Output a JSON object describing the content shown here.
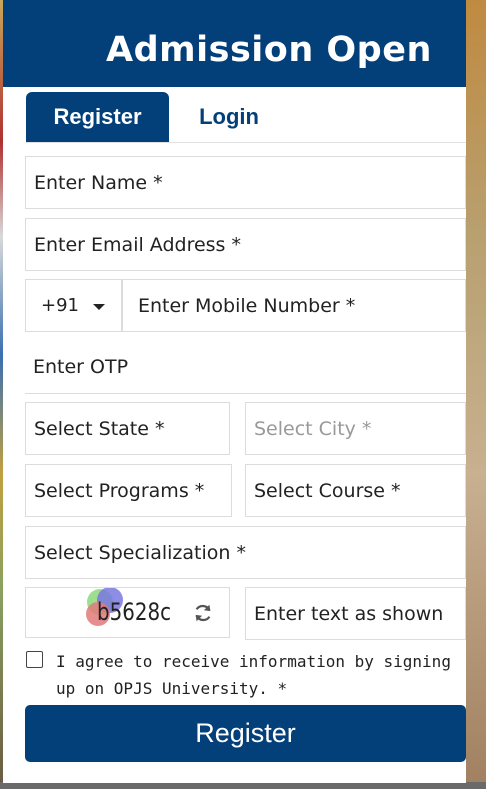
{
  "header": {
    "title": "Admission Open"
  },
  "tabs": [
    {
      "label": "Register",
      "active": true
    },
    {
      "label": "Login",
      "active": false
    }
  ],
  "form": {
    "name_placeholder": "Enter Name *",
    "email_placeholder": "Enter Email Address *",
    "country_code": "+91",
    "mobile_placeholder": "Enter Mobile Number *",
    "otp_placeholder": "Enter OTP",
    "state_placeholder": "Select State *",
    "city_placeholder": "Select City *",
    "programs_placeholder": "Select Programs *",
    "course_placeholder": "Select Course *",
    "specialization_placeholder": "Select Specialization *",
    "captcha_text": "b5628c",
    "captcha_input_placeholder": "Enter text as shown",
    "consent_text": "I agree to receive information by signing up on OPJS University. *",
    "consent_checked": false,
    "submit_label": "Register"
  },
  "colors": {
    "primary": "#03407a",
    "border": "#dcdcdc",
    "muted_text": "#999999"
  },
  "icons": {
    "dropdown": "chevron-down-icon",
    "refresh": "refresh-icon"
  }
}
